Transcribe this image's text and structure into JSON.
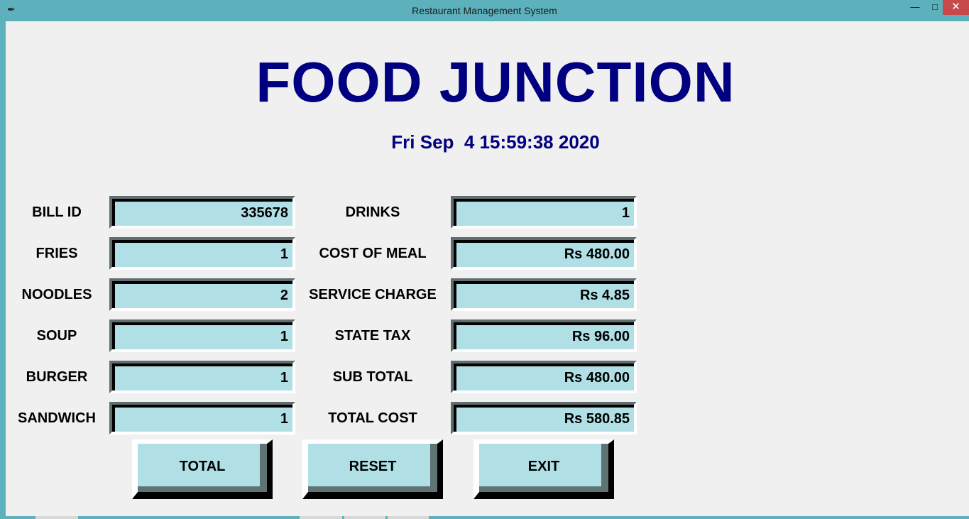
{
  "window": {
    "title": "Restaurant Management System",
    "minimize": "—",
    "maximize": "□",
    "close": "✕"
  },
  "header": {
    "title": "FOOD JUNCTION",
    "datetime": "Fri Sep  4 15:59:38 2020"
  },
  "left_fields": [
    {
      "label": "BILL ID",
      "value": "335678"
    },
    {
      "label": "FRIES",
      "value": "1"
    },
    {
      "label": "NOODLES",
      "value": "2"
    },
    {
      "label": "SOUP",
      "value": "1"
    },
    {
      "label": "BURGER",
      "value": "1"
    },
    {
      "label": "SANDWICH",
      "value": "1"
    }
  ],
  "right_fields": [
    {
      "label": "DRINKS",
      "value": "1"
    },
    {
      "label": "COST OF MEAL",
      "value": "Rs 480.00"
    },
    {
      "label": "SERVICE CHARGE",
      "value": "Rs 4.85"
    },
    {
      "label": "STATE TAX",
      "value": "Rs 96.00"
    },
    {
      "label": "SUB TOTAL",
      "value": "Rs 480.00"
    },
    {
      "label": "TOTAL COST",
      "value": "Rs 580.85"
    }
  ],
  "buttons": {
    "total": "TOTAL",
    "reset": "RESET",
    "exit": "EXIT"
  },
  "colors": {
    "title": "#000080",
    "field_bg": "#b0e0e6",
    "frame": "#5cb1bd",
    "client_bg": "#f0f0f0"
  }
}
